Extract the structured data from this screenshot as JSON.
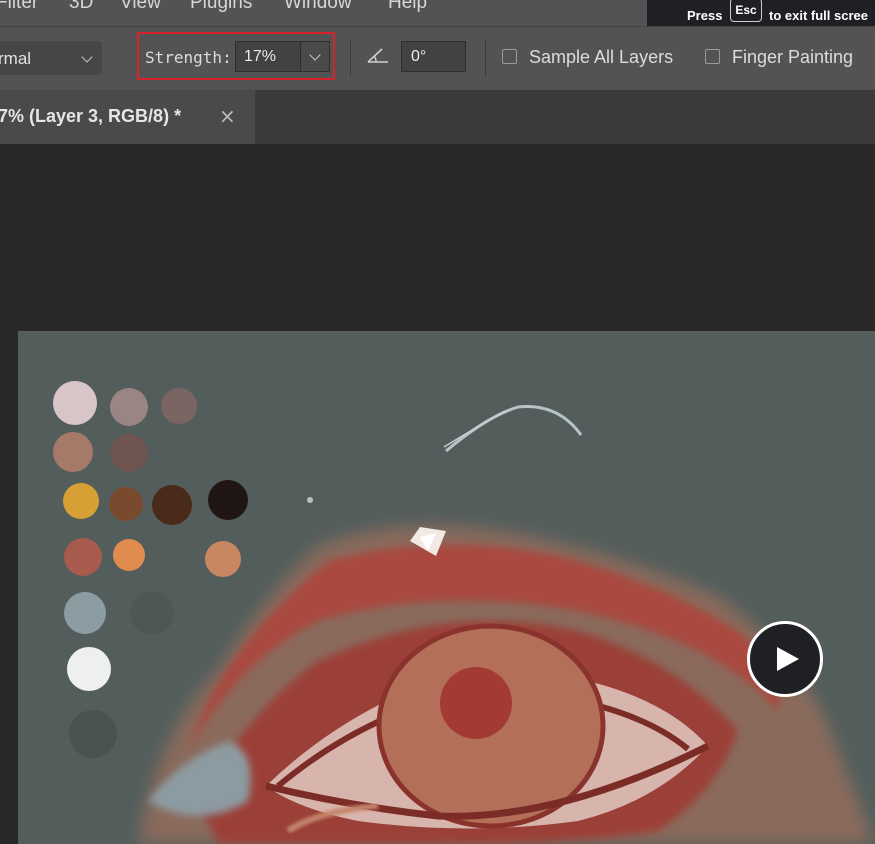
{
  "menu": [
    "Filter",
    "3D",
    "View",
    "Plugins",
    "Window",
    "Help"
  ],
  "fullscreen_notice": {
    "prefix": "Press",
    "key": "Esc",
    "suffix": "to exit full scree"
  },
  "options": {
    "mode_value": "rmal",
    "strength_label": "Strength:",
    "strength_value": "17%",
    "angle_value": "0°",
    "sample_all_layers": {
      "label": "Sample All Layers",
      "checked": false
    },
    "finger_painting": {
      "label": "Finger Painting",
      "checked": false
    }
  },
  "document_tab": {
    "title": "7% (Layer 3, RGB/8) *",
    "close": "×"
  },
  "colors": {
    "highlight": "#d6232b",
    "canvas": "#535e5c",
    "app_bg": "#282828",
    "toolbar": "#535353"
  },
  "icons": [
    "chevron-down-icon",
    "angle-icon",
    "close-icon",
    "play-icon"
  ]
}
